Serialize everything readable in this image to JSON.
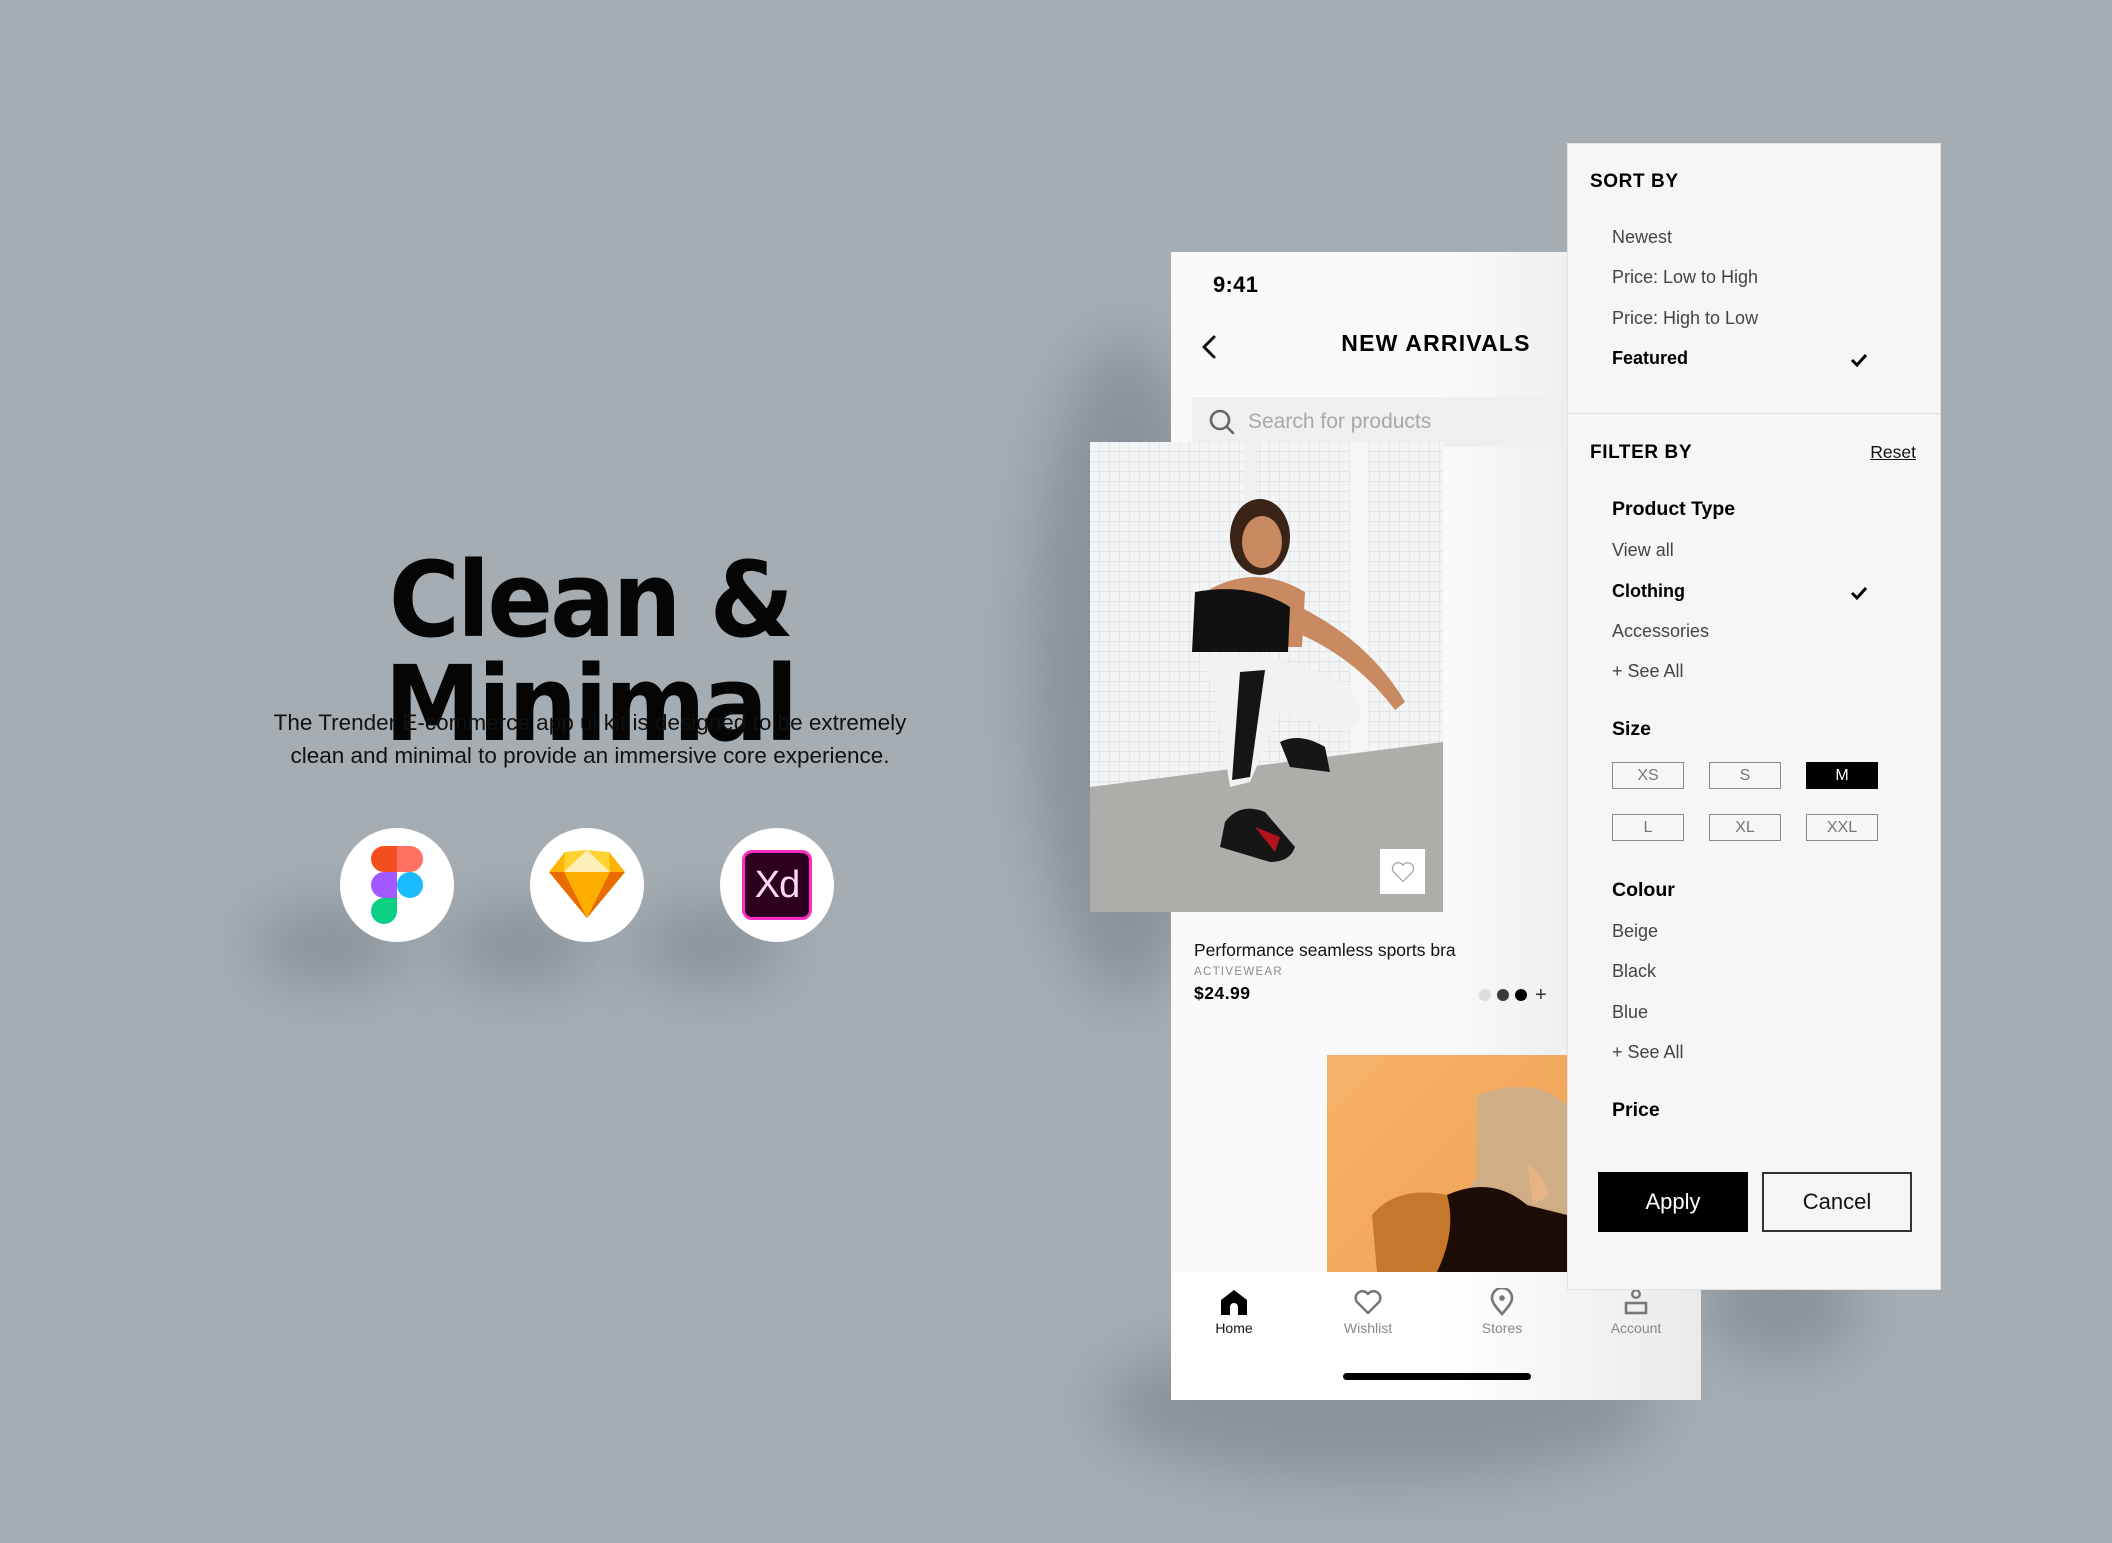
{
  "hero": {
    "title": "Clean & Minimal",
    "description_line1": "The Trender E-commerce app ui kit is designed to be extremely",
    "description_line2": "clean and minimal to provide an immersive core experience.",
    "tools": [
      {
        "name": "Figma",
        "icon": "figma-logo-icon"
      },
      {
        "name": "Sketch",
        "icon": "sketch-logo-icon"
      },
      {
        "name": "Adobe XD",
        "icon": "adobe-xd-logo-icon",
        "label": "Xd"
      }
    ]
  },
  "phone": {
    "status_time": "9:41",
    "page_title": "NEW ARRIVALS",
    "search": {
      "placeholder": "Search for products",
      "value": ""
    },
    "product": {
      "name": "Performance seamless sports bra",
      "category": "ACTIVEWEAR",
      "price": "$24.99",
      "swatches": [
        "#dddddd",
        "#3a3a3a",
        "#000000"
      ],
      "more_swatches": "+"
    },
    "bottom_nav": [
      {
        "label": "Home",
        "icon": "home-icon",
        "active": true
      },
      {
        "label": "Wishlist",
        "icon": "heart-icon",
        "active": false
      },
      {
        "label": "Stores",
        "icon": "location-pin-icon",
        "active": false
      },
      {
        "label": "Account",
        "icon": "account-icon",
        "active": false
      }
    ]
  },
  "filter_panel": {
    "sort_by": {
      "title": "SORT BY",
      "options": [
        "Newest",
        "Price: Low to High",
        "Price: High to Low",
        "Featured"
      ],
      "selected": "Featured"
    },
    "filter_by": {
      "title": "FILTER BY",
      "reset_label": "Reset",
      "product_type": {
        "title": "Product Type",
        "options": [
          "View all",
          "Clothing",
          "Accessories",
          "+ See All"
        ],
        "selected": "Clothing"
      },
      "size": {
        "title": "Size",
        "options": [
          "XS",
          "S",
          "M",
          "L",
          "XL",
          "XXL"
        ],
        "selected": "M"
      },
      "colour": {
        "title": "Colour",
        "options": [
          "Beige",
          "Black",
          "Blue",
          "+ See All"
        ]
      },
      "price": {
        "title": "Price"
      }
    },
    "apply_label": "Apply",
    "cancel_label": "Cancel"
  },
  "colors": {
    "background": "#a5adb3",
    "panel": "#f6f6f6",
    "accent": "#000000"
  }
}
